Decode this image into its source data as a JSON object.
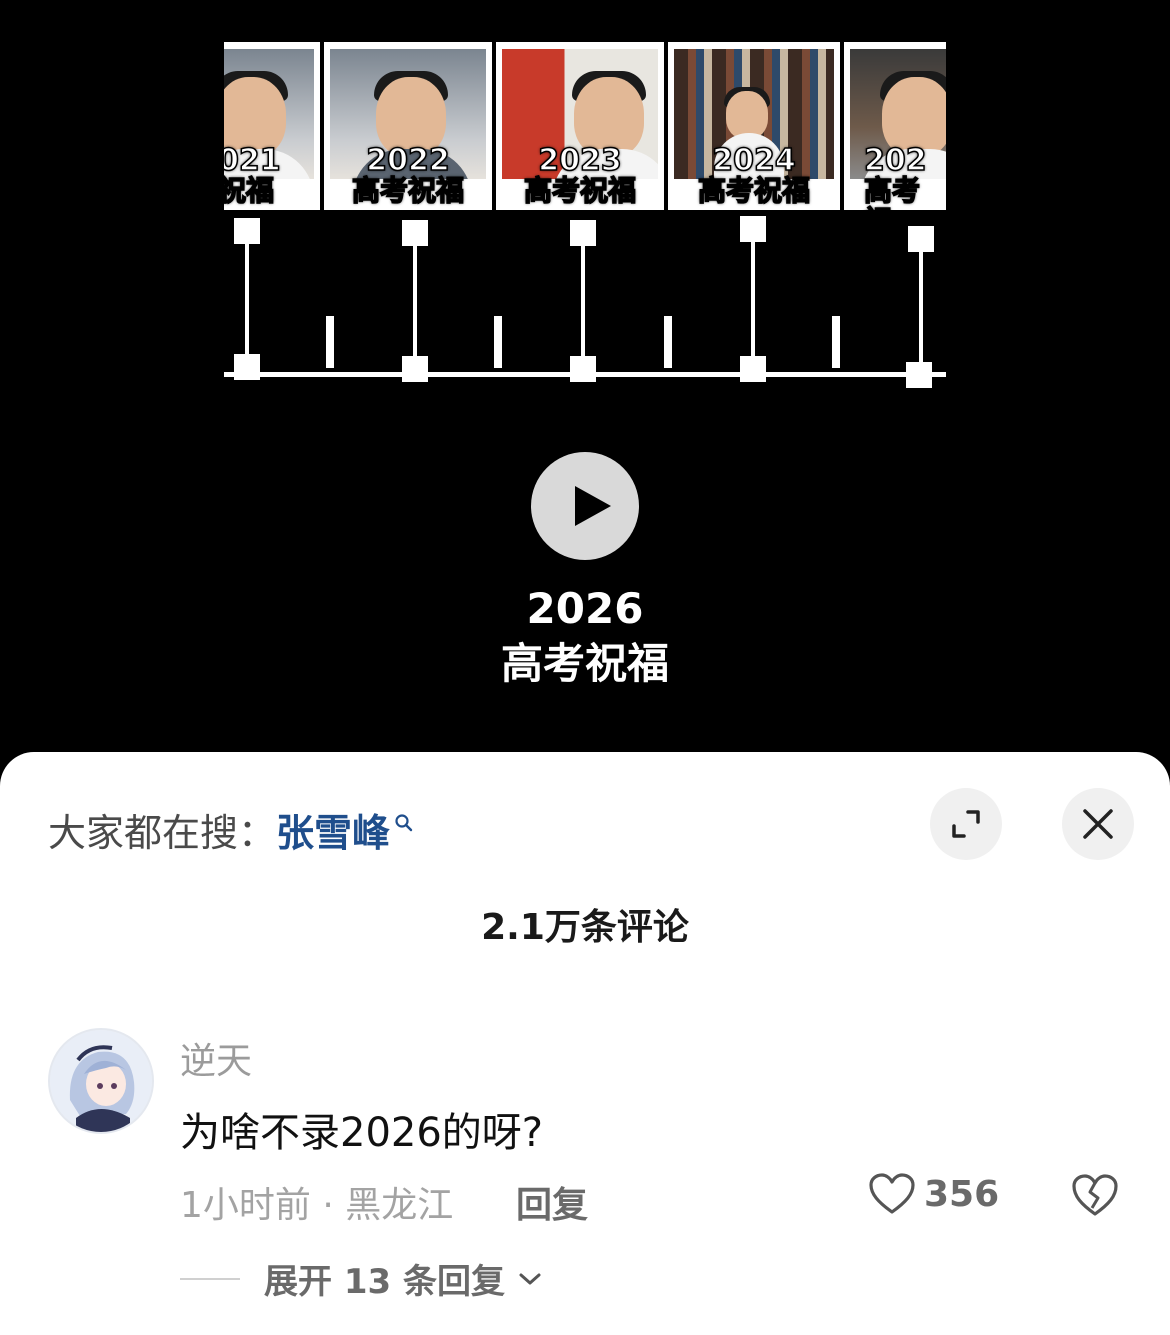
{
  "video": {
    "thumbnails": [
      {
        "year": "021",
        "wish": "祝福"
      },
      {
        "year": "2022",
        "wish": "高考祝福"
      },
      {
        "year": "2023",
        "wish": "高考祝福"
      },
      {
        "year": "2024",
        "wish": "高考祝福"
      },
      {
        "year": "202",
        "wish": "高考祝"
      }
    ],
    "center_year": "2026",
    "center_wish": "高考祝福"
  },
  "sheet": {
    "search_prefix": "大家都在搜：",
    "search_term": "张雪峰",
    "comment_count": "2.1万条评论"
  },
  "comment": {
    "username": "逆天",
    "text": "为啥不录2026的呀?",
    "meta": "1小时前 · 黑龙江",
    "reply_label": "回复",
    "likes": "356",
    "expand_label": "展开 13 条回复"
  },
  "icons": {
    "search": "search-icon",
    "expand": "expand-icon",
    "close": "close-icon",
    "like": "heart-icon",
    "dislike": "broken-heart-icon",
    "chevron": "chevron-down-icon",
    "play": "play-icon"
  },
  "colors": {
    "search_term": "#1f4e8c",
    "sheet_bg": "#ffffff",
    "video_bg": "#000000"
  }
}
